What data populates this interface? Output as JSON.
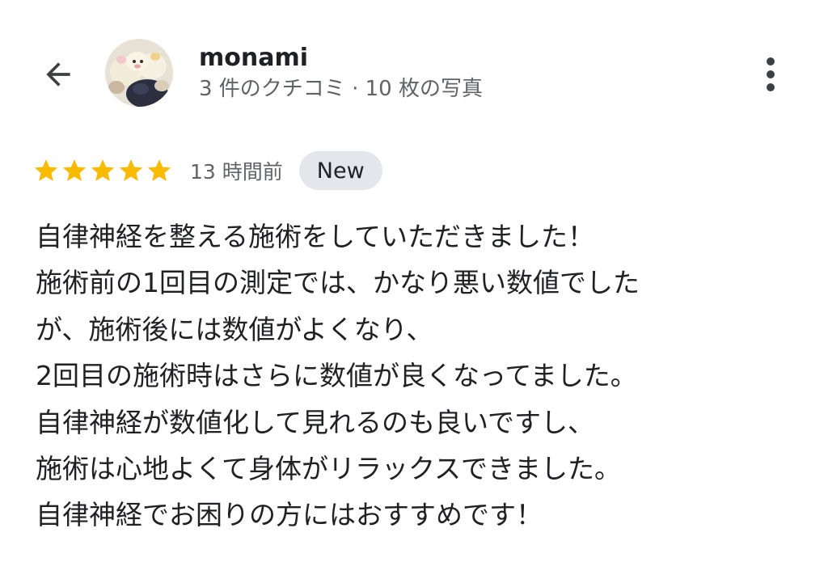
{
  "header": {
    "back_icon": "arrow-back-icon",
    "more_icon": "more-vert-icon",
    "avatar_icon": "user-avatar-photo"
  },
  "reviewer": {
    "name": "monami",
    "meta": "3 件のクチコミ · 10 枚の写真"
  },
  "review": {
    "rating": 5,
    "rating_max": 5,
    "star_color": "#f9bb00",
    "time": "13 時間前",
    "badge": "New",
    "lines": [
      "自律神経を整える施術をしていただきました！",
      "施術前の1回目の測定では、かなり悪い数値でした",
      "が、施術後には数値がよくなり、",
      "2回目の施術時はさらに数値が良くなってました。",
      "自律神経が数値化して見れるのも良いですし、",
      "施術は心地よくて身体がリラックスできました。",
      "自律神経でお困りの方にはおすすめです！"
    ]
  }
}
